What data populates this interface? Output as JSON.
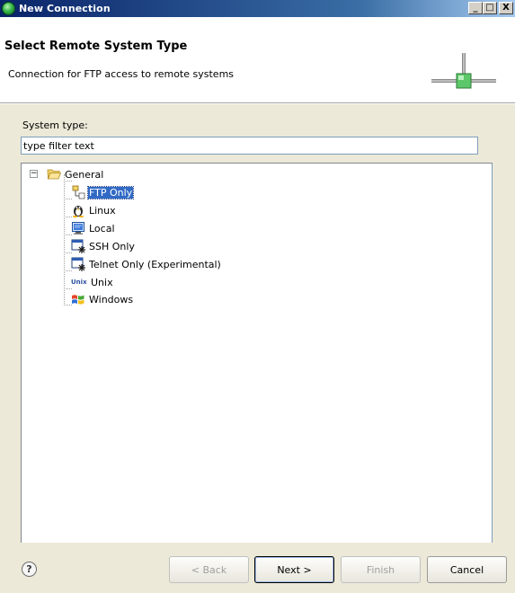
{
  "window": {
    "title": "New Connection",
    "controls": {
      "minimize": "_",
      "maximize": "□",
      "close": "X"
    }
  },
  "header": {
    "title": "Select Remote System Type",
    "description": "Connection for FTP access to remote systems",
    "graphic_icon": "network-connection-icon"
  },
  "system_type": {
    "label": "System type:",
    "filter_placeholder": "type filter text",
    "filter_value": "type filter text"
  },
  "tree": {
    "root": {
      "label": "General",
      "expanded": true,
      "expander": "−",
      "icon": "folder-open-icon"
    },
    "items": [
      {
        "label": "FTP Only",
        "icon": "ftp-icon",
        "selected": true
      },
      {
        "label": "Linux",
        "icon": "linux-tux-icon",
        "selected": false
      },
      {
        "label": "Local",
        "icon": "local-computer-icon",
        "selected": false
      },
      {
        "label": "SSH Only",
        "icon": "ssh-terminal-icon",
        "selected": false
      },
      {
        "label": "Telnet Only (Experimental)",
        "icon": "telnet-terminal-icon",
        "selected": false
      },
      {
        "label": "Unix",
        "icon": "unix-icon",
        "icon_text": "Unix",
        "selected": false
      },
      {
        "label": "Windows",
        "icon": "windows-flag-icon",
        "selected": false
      }
    ]
  },
  "buttons": {
    "help": "?",
    "back": "< Back",
    "next": "Next >",
    "finish": "Finish",
    "cancel": "Cancel"
  },
  "colors": {
    "selection": "#316ac5",
    "dialog_background": "#ece9d8",
    "title_gradient_start": "#0a246a"
  }
}
